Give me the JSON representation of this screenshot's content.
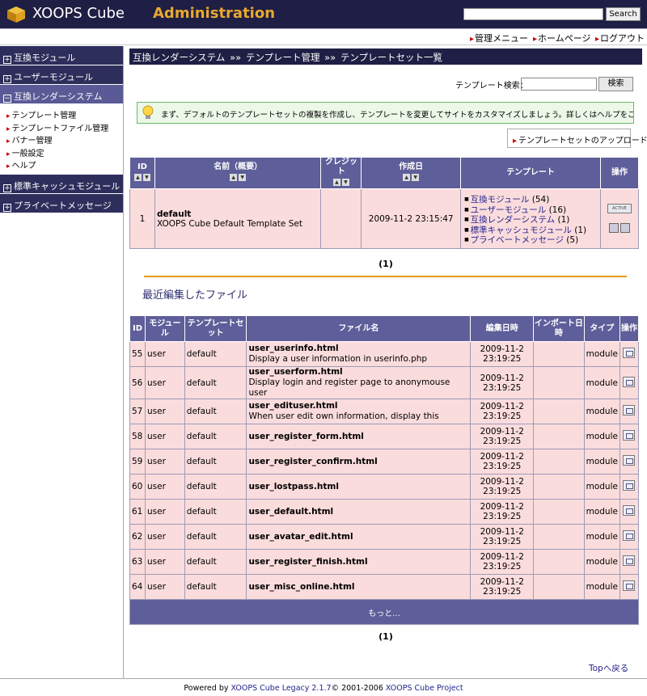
{
  "header": {
    "brand": "XOOPS Cube",
    "brand_sub": "Administration",
    "search_button": "Search"
  },
  "toplinks": {
    "admin_menu": "管理メニュー",
    "home": "ホームページ",
    "logout": "ログアウト"
  },
  "sidebar": {
    "sections": [
      {
        "label": "互換モジュール"
      },
      {
        "label": "ユーザーモジュール"
      },
      {
        "label": "互換レンダーシステム"
      },
      {
        "label": "標準キャッシュモジュール"
      },
      {
        "label": "プライベートメッセージ"
      }
    ],
    "sub_items": [
      {
        "label": "テンプレート管理"
      },
      {
        "label": "テンプレートファイル管理"
      },
      {
        "label": "バナー管理"
      },
      {
        "label": "一般設定"
      },
      {
        "label": "ヘルプ"
      }
    ]
  },
  "breadcrumb": {
    "part1": "互換レンダーシステム",
    "sep": "»»",
    "part2": "テンプレート管理",
    "part3": "テンプレートセット一覧"
  },
  "template_search": {
    "label": "テンプレート検索：",
    "button": "検索"
  },
  "tip": "まず、デフォルトのテンプレートセットの複製を作成し、テンプレートを変更してサイトをカスタマイズしましょう。詳しくはヘルプをご覧ください。",
  "upload_button": "テンプレートセットのアップロード",
  "sets_table": {
    "headers": {
      "id": "ID",
      "name": "名前（概要）",
      "credit": "クレジット",
      "created": "作成日",
      "template": "テンプレート",
      "ops": "操作"
    },
    "row": {
      "id": "1",
      "name": "default",
      "desc": "XOOPS Cube Default Template Set",
      "credit": "",
      "created": "2009-11-2 23:15:47",
      "active_label": "ACTIVE",
      "templates": [
        {
          "link": "互換モジュール",
          "count": "(54)"
        },
        {
          "link": "ユーザーモジュール",
          "count": "(16)"
        },
        {
          "link": "互換レンダーシステム",
          "count": "(1)"
        },
        {
          "link": "標準キャッシュモジュール",
          "count": "(1)"
        },
        {
          "link": "プライベートメッセージ",
          "count": "(5)"
        }
      ]
    }
  },
  "pager1": "(1)",
  "recent_title": "最近編集したファイル",
  "files_table": {
    "headers": {
      "id": "ID",
      "module": "モジュール",
      "tplset": "テンプレートセット",
      "filename": "ファイル名",
      "edited": "編集日時",
      "imported": "インポート日時",
      "type": "タイプ",
      "ops": "操作"
    },
    "rows": [
      {
        "id": "55",
        "module": "user",
        "tplset": "default",
        "file": "user_userinfo.html",
        "desc": "Display a user information in userinfo.php",
        "date": "2009-11-2",
        "time": "23:19:25",
        "type": "module"
      },
      {
        "id": "56",
        "module": "user",
        "tplset": "default",
        "file": "user_userform.html",
        "desc": "Display login and register page to anonymouse user",
        "date": "2009-11-2",
        "time": "23:19:25",
        "type": "module"
      },
      {
        "id": "57",
        "module": "user",
        "tplset": "default",
        "file": "user_edituser.html",
        "desc": "When user edit own information, display this",
        "date": "2009-11-2",
        "time": "23:19:25",
        "type": "module"
      },
      {
        "id": "58",
        "module": "user",
        "tplset": "default",
        "file": "user_register_form.html",
        "desc": "",
        "date": "2009-11-2",
        "time": "23:19:25",
        "type": "module"
      },
      {
        "id": "59",
        "module": "user",
        "tplset": "default",
        "file": "user_register_confirm.html",
        "desc": "",
        "date": "2009-11-2",
        "time": "23:19:25",
        "type": "module"
      },
      {
        "id": "60",
        "module": "user",
        "tplset": "default",
        "file": "user_lostpass.html",
        "desc": "",
        "date": "2009-11-2",
        "time": "23:19:25",
        "type": "module"
      },
      {
        "id": "61",
        "module": "user",
        "tplset": "default",
        "file": "user_default.html",
        "desc": "",
        "date": "2009-11-2",
        "time": "23:19:25",
        "type": "module"
      },
      {
        "id": "62",
        "module": "user",
        "tplset": "default",
        "file": "user_avatar_edit.html",
        "desc": "",
        "date": "2009-11-2",
        "time": "23:19:25",
        "type": "module"
      },
      {
        "id": "63",
        "module": "user",
        "tplset": "default",
        "file": "user_register_finish.html",
        "desc": "",
        "date": "2009-11-2",
        "time": "23:19:25",
        "type": "module"
      },
      {
        "id": "64",
        "module": "user",
        "tplset": "default",
        "file": "user_misc_online.html",
        "desc": "",
        "date": "2009-11-2",
        "time": "23:19:25",
        "type": "module"
      }
    ],
    "more": "もっと..."
  },
  "pager2": "(1)",
  "top_link": "Topへ戻る",
  "footer": {
    "prefix": "Powered by ",
    "link1": "XOOPS Cube Legacy 2.1.7",
    "mid": "© 2001-2006 ",
    "link2": "XOOPS Cube Project"
  }
}
